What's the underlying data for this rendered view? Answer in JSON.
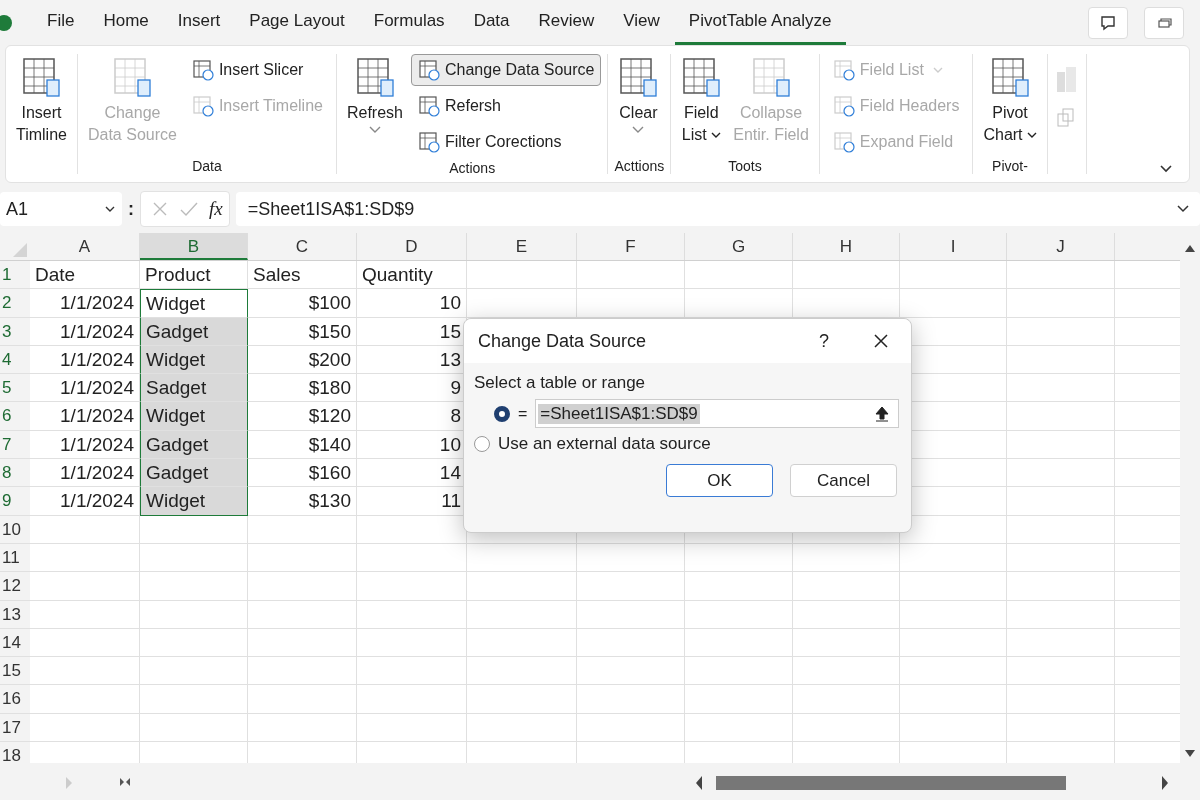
{
  "menu": {
    "tabs": [
      {
        "label": "File",
        "selected": false
      },
      {
        "label": "Home",
        "selected": false
      },
      {
        "label": "Insert",
        "selected": false
      },
      {
        "label": "Page Layout",
        "selected": false
      },
      {
        "label": "Formulas",
        "selected": false
      },
      {
        "label": "Data",
        "selected": false
      },
      {
        "label": "Review",
        "selected": false
      },
      {
        "label": "View",
        "selected": false
      },
      {
        "label": "PivotTable Analyze",
        "selected": true
      }
    ]
  },
  "ribbon": {
    "groups": [
      {
        "items": [
          {
            "kind": "large",
            "lines": [
              "Insert",
              "Timline"
            ],
            "disabled": false,
            "dropdown": false
          }
        ]
      },
      {
        "label": "Data",
        "items": [
          {
            "kind": "large",
            "lines": [
              "Change",
              "Data Source"
            ],
            "disabled": true,
            "dropdown": false
          },
          {
            "kind": "stack",
            "items": [
              {
                "label": "Insert Slicer",
                "disabled": false,
                "highlighted": false
              },
              {
                "label": "Insert Timeline",
                "disabled": true,
                "highlighted": false
              }
            ]
          }
        ]
      },
      {
        "label": "Actions",
        "items": [
          {
            "kind": "large",
            "lines": [
              "Refresh"
            ],
            "disabled": false,
            "dropdown": true
          },
          {
            "kind": "stack",
            "items": [
              {
                "label": "Change Data Source",
                "disabled": false,
                "highlighted": true
              },
              {
                "label": "Refersh",
                "disabled": false,
                "highlighted": false
              },
              {
                "label": "Filter Corections",
                "disabled": false,
                "highlighted": false
              }
            ]
          }
        ]
      },
      {
        "label": "Acttions",
        "items": [
          {
            "kind": "large",
            "lines": [
              "Clear"
            ],
            "disabled": false,
            "dropdown": true
          }
        ]
      },
      {
        "label": "Toots",
        "items": [
          {
            "kind": "large",
            "lines": [
              "Field",
              "List"
            ],
            "disabled": false,
            "dropdown": true
          },
          {
            "kind": "large",
            "lines": [
              "Collapse",
              "Entir. Field"
            ],
            "disabled": true,
            "dropdown": false
          }
        ]
      },
      {
        "items": [
          {
            "kind": "stack",
            "items": [
              {
                "label": "Field List",
                "disabled": true,
                "highlighted": false,
                "dropdown": true
              },
              {
                "label": "Field Headers",
                "disabled": true,
                "highlighted": false
              },
              {
                "label": "Expand Field",
                "disabled": true,
                "highlighted": false
              }
            ]
          }
        ]
      },
      {
        "label": "Pivot-",
        "items": [
          {
            "kind": "large",
            "lines": [
              "Pivot",
              "Chart"
            ],
            "disabled": false,
            "dropdown": true
          }
        ]
      },
      {
        "items": [
          {
            "kind": "icons",
            "disabled": true
          }
        ]
      }
    ]
  },
  "formula_bar": {
    "name_box": "A1",
    "separator": ":",
    "fx": "fx",
    "value": "=Sheet1ISA$1:SD$9"
  },
  "sheet": {
    "columns": [
      {
        "label": "A",
        "selected": false
      },
      {
        "label": "B",
        "selected": true
      },
      {
        "label": "C",
        "selected": false
      },
      {
        "label": "D",
        "selected": false
      },
      {
        "label": "E",
        "selected": false
      },
      {
        "label": "F",
        "selected": false
      },
      {
        "label": "G",
        "selected": false
      },
      {
        "label": "H",
        "selected": false
      },
      {
        "label": "I",
        "selected": false
      },
      {
        "label": "J",
        "selected": false
      }
    ],
    "rows": [
      {
        "number": "1",
        "cells": [
          "Date",
          "Product",
          "Sales",
          "Quantity"
        ]
      },
      {
        "number": "2",
        "cells": [
          "1/1/2024",
          "Widget",
          "$100",
          "10"
        ]
      },
      {
        "number": "3",
        "cells": [
          "1/1/2024",
          "Gadget",
          "$150",
          "15"
        ]
      },
      {
        "number": "4",
        "cells": [
          "1/1/2024",
          "Widget",
          "$200",
          "13"
        ]
      },
      {
        "number": "5",
        "cells": [
          "1/1/2024",
          "Sadget",
          "$180",
          "9"
        ]
      },
      {
        "number": "6",
        "cells": [
          "1/1/2024",
          "Widget",
          "$120",
          "8"
        ]
      },
      {
        "number": "7",
        "cells": [
          "1/1/2024",
          "Gadget",
          "$140",
          "10"
        ]
      },
      {
        "number": "8",
        "cells": [
          "1/1/2024",
          "Gadget",
          "$160",
          "14"
        ]
      },
      {
        "number": "9",
        "cells": [
          "1/1/2024",
          "Widget",
          "$130",
          "11"
        ]
      },
      {
        "number": "10",
        "cells": []
      },
      {
        "number": "11",
        "cells": []
      },
      {
        "number": "12",
        "cells": []
      },
      {
        "number": "13",
        "cells": []
      },
      {
        "number": "14",
        "cells": []
      },
      {
        "number": "15",
        "cells": []
      },
      {
        "number": "16",
        "cells": []
      },
      {
        "number": "17",
        "cells": []
      },
      {
        "number": "18",
        "cells": []
      }
    ]
  },
  "dialog": {
    "title": "Change Data Source",
    "help": "?",
    "section": "Select a table or range",
    "options": [
      {
        "kind": "range",
        "label": "=",
        "value": "=Sheet1ISA$1:SD$9",
        "selected": true
      },
      {
        "kind": "text",
        "label": "Use an external data source",
        "selected": false
      }
    ],
    "buttons": [
      {
        "label": "OK",
        "primary": true
      },
      {
        "label": "Cancel",
        "primary": false
      }
    ]
  }
}
